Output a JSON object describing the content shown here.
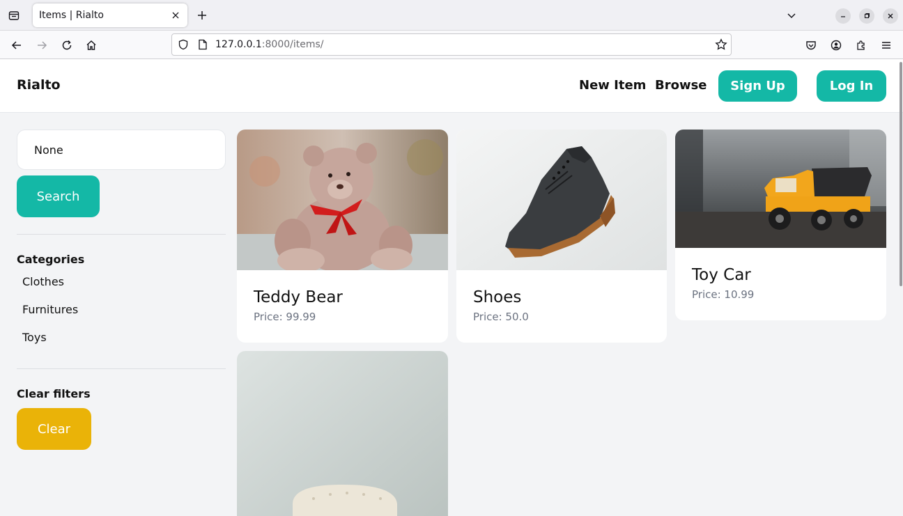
{
  "browser": {
    "tab_title": "Items | Rialto",
    "url_host": "127.0.0.1",
    "url_rest": ":8000/items/"
  },
  "header": {
    "brand": "Rialto",
    "nav": [
      {
        "label": "New Item"
      },
      {
        "label": "Browse"
      }
    ],
    "signup_label": "Sign Up",
    "login_label": "Log In"
  },
  "sidebar": {
    "search_value": "None",
    "search_button": "Search",
    "categories_heading": "Categories",
    "categories": [
      {
        "label": "Clothes"
      },
      {
        "label": "Furnitures"
      },
      {
        "label": "Toys"
      }
    ],
    "clear_heading": "Clear filters",
    "clear_button": "Clear"
  },
  "items": [
    {
      "title": "Teddy Bear",
      "price": "Price: 99.99",
      "image": "teddy-bear"
    },
    {
      "title": "Shoes",
      "price": "Price: 50.0",
      "image": "shoe"
    },
    {
      "title": "Toy Car",
      "price": "Price: 10.99",
      "image": "toy-truck"
    },
    {
      "title": "",
      "price": "",
      "image": "armchair"
    }
  ],
  "colors": {
    "accent": "#14b8a6",
    "clear": "#eab308",
    "page_bg": "#f3f4f6",
    "muted_text": "#6b7280"
  }
}
